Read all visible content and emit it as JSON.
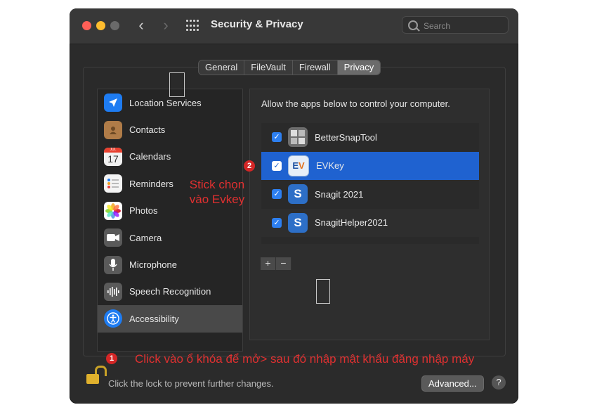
{
  "window": {
    "title": "Security & Privacy",
    "search_placeholder": "Search"
  },
  "tabs": [
    "General",
    "FileVault",
    "Firewall",
    "Privacy"
  ],
  "active_tab": "Privacy",
  "sidebar": {
    "items": [
      {
        "label": "Location Services",
        "icon": "location-arrow-icon",
        "color": "#1e7cf2"
      },
      {
        "label": "Contacts",
        "icon": "contacts-book-icon",
        "color": "#b07c48"
      },
      {
        "label": "Calendars",
        "icon": "calendar-icon",
        "color": "#f1f1f1",
        "day": "17",
        "month": "JUL"
      },
      {
        "label": "Reminders",
        "icon": "reminders-list-icon",
        "color": "#f4f4f4"
      },
      {
        "label": "Photos",
        "icon": "photos-flower-icon",
        "color": "#ffffff"
      },
      {
        "label": "Camera",
        "icon": "camera-icon",
        "color": "#5a5a5a"
      },
      {
        "label": "Microphone",
        "icon": "microphone-icon",
        "color": "#5a5a5a"
      },
      {
        "label": "Speech Recognition",
        "icon": "waveform-icon",
        "color": "#5a5a5a"
      },
      {
        "label": "Accessibility",
        "icon": "accessibility-icon",
        "color": "#1e7cf2"
      }
    ],
    "selected": "Accessibility"
  },
  "panel": {
    "heading": "Allow the apps below to control your computer.",
    "apps": [
      {
        "name": "BetterSnapTool",
        "checked": true,
        "icon": "bettersnaptool-icon"
      },
      {
        "name": "EVKey",
        "checked": true,
        "icon": "evkey-icon",
        "selected": true
      },
      {
        "name": "Snagit 2021",
        "checked": true,
        "icon": "snagit-icon"
      },
      {
        "name": "SnagitHelper2021",
        "checked": true,
        "icon": "snagit-helper-icon"
      }
    ],
    "add_label": "+",
    "remove_label": "−"
  },
  "footer": {
    "lock_text": "Click the lock to prevent further changes.",
    "advanced_label": "Advanced...",
    "help_label": "?"
  },
  "annotations": {
    "step1_badge": "1",
    "step1_text": "Click vào ổ khóa để mở> sau đó nhập mật khẩu đăng nhập máy",
    "step2_badge": "2",
    "step2_text_line1": "Stick chọn",
    "step2_text_line2": "vào Evkey",
    "color": "#e03030"
  }
}
